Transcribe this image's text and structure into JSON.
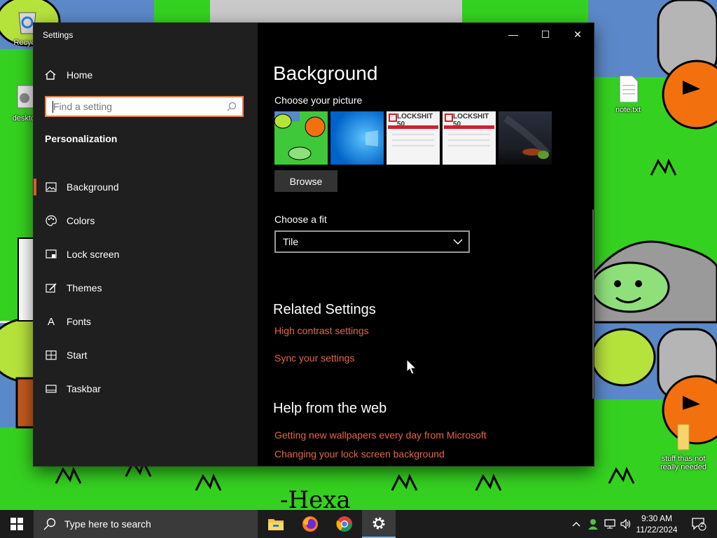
{
  "desktop": {
    "icons": [
      {
        "label": "Recycle"
      },
      {
        "label": "desktop"
      },
      {
        "label": "note.txt"
      },
      {
        "label": "stuff thas not really needed"
      }
    ],
    "wallpaper_text": "-Hexa"
  },
  "window": {
    "title": "Settings",
    "controls": {
      "minimize": "—",
      "maximize": "☐",
      "close": "✕"
    }
  },
  "sidebar": {
    "home_label": "Home",
    "search_placeholder": "Find a setting",
    "section_title": "Personalization",
    "items": [
      {
        "label": "Background",
        "icon": "image-icon",
        "active": true
      },
      {
        "label": "Colors",
        "icon": "palette-icon"
      },
      {
        "label": "Lock screen",
        "icon": "lock-screen-icon"
      },
      {
        "label": "Themes",
        "icon": "brush-icon"
      },
      {
        "label": "Fonts",
        "icon": "font-icon"
      },
      {
        "label": "Start",
        "icon": "start-grid-icon"
      },
      {
        "label": "Taskbar",
        "icon": "taskbar-icon"
      }
    ]
  },
  "content": {
    "title": "Background",
    "choose_picture_label": "Choose your picture",
    "thumbnails": [
      {
        "name": "desktop-drawing"
      },
      {
        "name": "windows-blue"
      },
      {
        "name": "lockshit-1",
        "text": "LOCKSHIT 50"
      },
      {
        "name": "lockshit-2",
        "text": "LOCKSHIT 50"
      },
      {
        "name": "night-sky"
      }
    ],
    "browse_label": "Browse",
    "choose_fit_label": "Choose a fit",
    "fit_value": "Tile",
    "related_title": "Related Settings",
    "related_links": [
      "High contrast settings",
      "Sync your settings"
    ],
    "help_title": "Help from the web",
    "help_links": [
      "Getting new wallpapers every day from Microsoft",
      "Changing your lock screen background"
    ]
  },
  "taskbar": {
    "search_placeholder": "Type here to search",
    "apps": [
      {
        "name": "file-explorer-icon"
      },
      {
        "name": "firefox-icon"
      },
      {
        "name": "chrome-icon"
      },
      {
        "name": "settings-icon",
        "active": true
      }
    ],
    "time": "9:30 AM",
    "date": "11/22/2024",
    "notification_count": "2"
  },
  "colors": {
    "accent": "#e0582a",
    "link": "#e8654a",
    "sidebar_bg": "#1f1f1f"
  }
}
